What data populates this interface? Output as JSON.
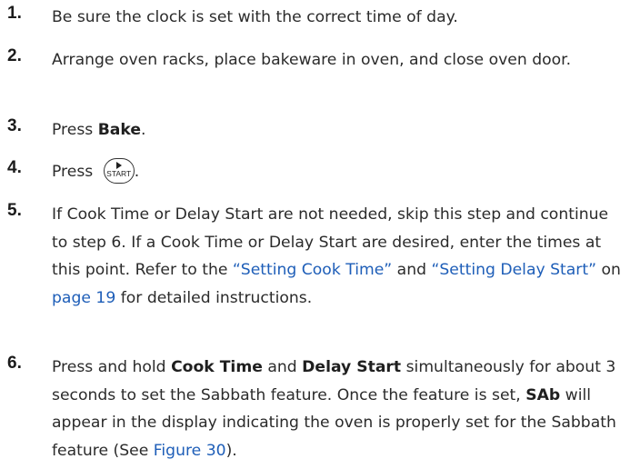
{
  "steps": [
    {
      "number": "1.",
      "text": "Be sure the clock is set with the correct time of day."
    },
    {
      "number": "2.",
      "text": "Arrange oven racks, place bakeware in oven, and close oven door."
    },
    {
      "number": "3.",
      "prefix": "Press ",
      "bold": "Bake",
      "suffix": "."
    },
    {
      "number": "4.",
      "prefix": "Press ",
      "button_label": "START",
      "button_icon": "play-icon",
      "suffix": "."
    },
    {
      "number": "5.",
      "part1": "If Cook Time or Delay Start are not needed, skip this step and continue to step 6. If a Cook Time or Delay Start are desired, enter the times at this point. Refer to the ",
      "link1": "“Setting Cook Time”",
      "part2": " and ",
      "link2": "“Setting Delay Start”",
      "part3": " on ",
      "link3": "page 19",
      "part4": " for detailed instructions."
    },
    {
      "number": "6.",
      "part1": "Press and hold ",
      "bold1": "Cook Time",
      "part2": " and ",
      "bold2": "Delay Start",
      "part3": " simultaneously for about 3 seconds to set the Sabbath feature. Once the feature is set, ",
      "bold3": "SAb",
      "part4": " will appear in the display indicating the oven is properly set for the Sabbath feature (See ",
      "link1": "Figure 30",
      "part5": ")."
    }
  ],
  "colors": {
    "text": "#2b2b2b",
    "link": "#1e5eb8"
  }
}
